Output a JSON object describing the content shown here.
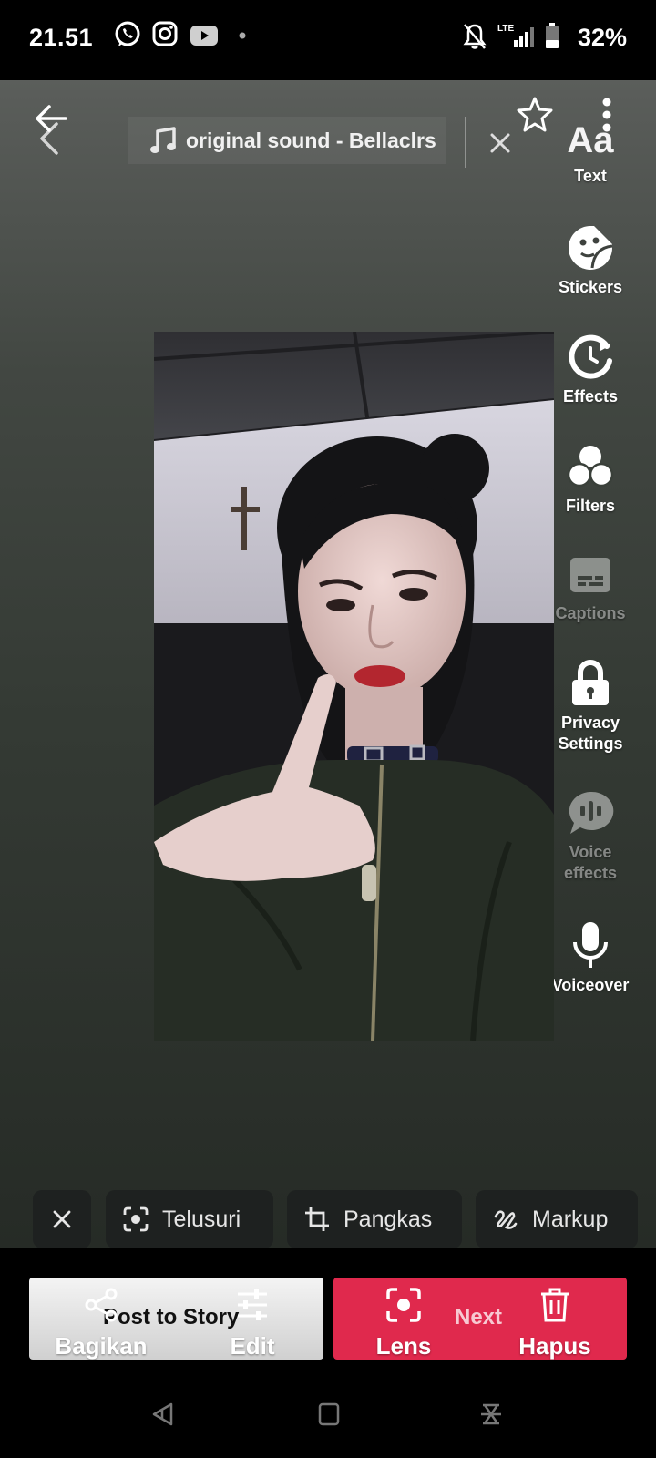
{
  "status_bar": {
    "time": "21.51",
    "battery_percent": "32%",
    "network": "LTE",
    "icons": [
      "whatsapp-icon",
      "instagram-icon",
      "youtube-icon",
      "dot-icon",
      "mute-icon",
      "signal-icon",
      "battery-icon"
    ]
  },
  "editor": {
    "sound_label": "original sound - Bellaclrs",
    "tools": [
      {
        "label": "Text",
        "icon": "text-icon"
      },
      {
        "label": "Stickers",
        "icon": "sticker-icon"
      },
      {
        "label": "Effects",
        "icon": "effects-icon"
      },
      {
        "label": "Filters",
        "icon": "filters-icon"
      },
      {
        "label": "Captions",
        "icon": "captions-icon"
      },
      {
        "label_line1": "Privacy",
        "label_line2": "Settings",
        "icon": "lock-icon"
      },
      {
        "label_line1": "Voice",
        "label_line2": "effects",
        "icon": "voice-effects-icon"
      },
      {
        "label": "Voiceover",
        "icon": "microphone-icon"
      }
    ]
  },
  "lens_chips": {
    "search": "Telusuri",
    "crop": "Pangkas",
    "markup": "Markup"
  },
  "bottom": {
    "post_to_story": "Post to Story",
    "next": "Next",
    "actions": {
      "share": "Bagikan",
      "edit": "Edit",
      "lens": "Lens",
      "delete": "Hapus"
    }
  },
  "colors": {
    "next_button": "#e0294d",
    "chip_background": "#1e2120"
  }
}
